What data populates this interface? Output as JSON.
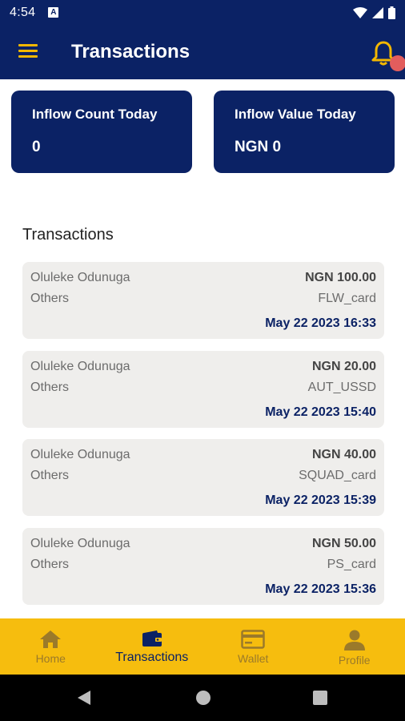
{
  "status_bar": {
    "time": "4:54",
    "notification_letter": "A"
  },
  "app_bar": {
    "title": "Transactions"
  },
  "summary": [
    {
      "label": "Inflow Count Today",
      "value": "0"
    },
    {
      "label": "Inflow Value Today",
      "value": "NGN 0"
    }
  ],
  "section_title": "Transactions",
  "transactions": [
    {
      "name": "Oluleke Odunuga",
      "category": "Others",
      "amount": "NGN 100.00",
      "channel": "FLW_card",
      "date": "May 22 2023 16:33"
    },
    {
      "name": "Oluleke Odunuga",
      "category": "Others",
      "amount": "NGN 20.00",
      "channel": "AUT_USSD",
      "date": "May 22 2023 15:40"
    },
    {
      "name": "Oluleke Odunuga",
      "category": "Others",
      "amount": "NGN 40.00",
      "channel": "SQUAD_card",
      "date": "May 22 2023 15:39"
    },
    {
      "name": "Oluleke Odunuga",
      "category": "Others",
      "amount": "NGN 50.00",
      "channel": "PS_card",
      "date": "May 22 2023 15:36"
    }
  ],
  "bottom_nav": {
    "active": "Transactions",
    "items": [
      {
        "label": "Home",
        "icon": "home-icon"
      },
      {
        "label": "Transactions",
        "icon": "wallet-icon"
      },
      {
        "label": "Wallet",
        "icon": "card-icon"
      },
      {
        "label": "Profile",
        "icon": "person-icon"
      }
    ]
  },
  "colors": {
    "primary": "#0b2265",
    "accent": "#f6bd0e",
    "badge": "#e25d5d",
    "card_bg": "#efeeec"
  }
}
